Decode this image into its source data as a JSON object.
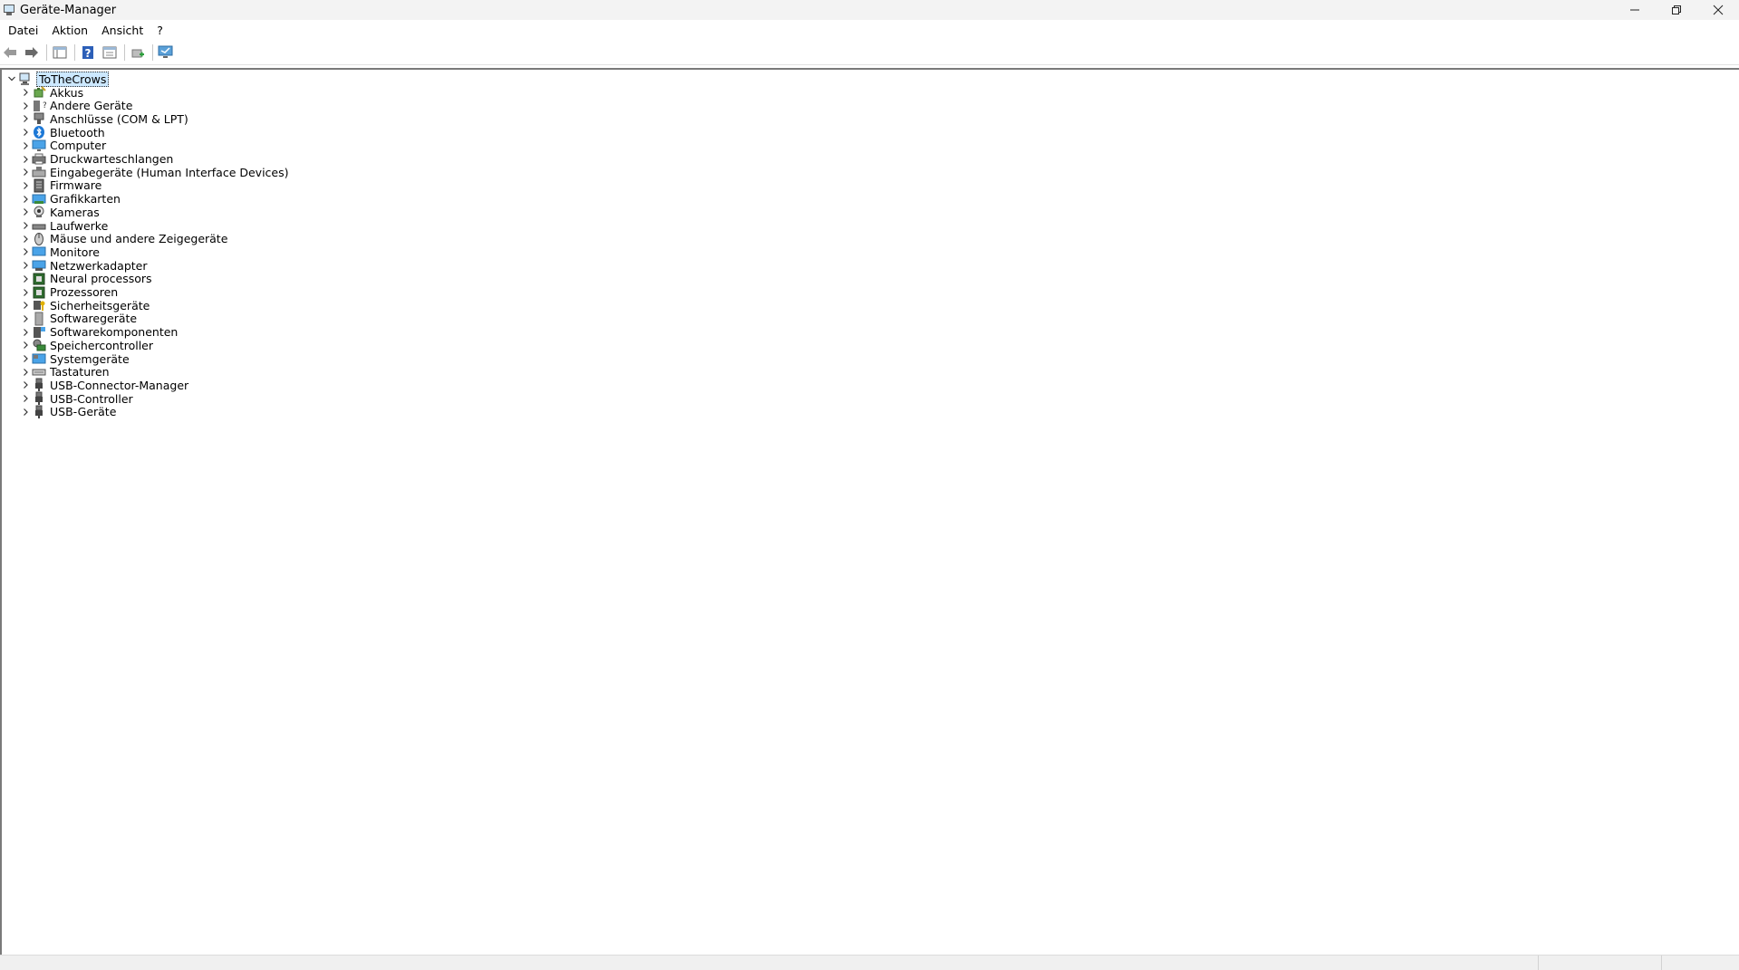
{
  "window": {
    "title": "Geräte-Manager"
  },
  "menu": [
    "Datei",
    "Aktion",
    "Ansicht",
    "?"
  ],
  "toolbar": {
    "buttons": [
      "back-arrow-icon",
      "forward-arrow-icon",
      "console-tree-icon",
      "help-icon",
      "properties-icon",
      "update-driver-icon",
      "scan-hardware-icon"
    ]
  },
  "tree": {
    "root": {
      "label": "ToTheCrows",
      "expanded": true,
      "selected": true,
      "icon": "computer-icon"
    },
    "categories": [
      {
        "label": "Akkus",
        "icon": "battery-icon"
      },
      {
        "label": "Andere Geräte",
        "icon": "unknown-device-icon"
      },
      {
        "label": "Anschlüsse (COM & LPT)",
        "icon": "port-icon"
      },
      {
        "label": "Bluetooth",
        "icon": "bluetooth-icon"
      },
      {
        "label": "Computer",
        "icon": "computer-icon"
      },
      {
        "label": "Druckwarteschlangen",
        "icon": "printer-icon"
      },
      {
        "label": "Eingabegeräte (Human Interface Devices)",
        "icon": "hid-icon"
      },
      {
        "label": "Firmware",
        "icon": "firmware-icon"
      },
      {
        "label": "Grafikkarten",
        "icon": "display-adapter-icon"
      },
      {
        "label": "Kameras",
        "icon": "camera-icon"
      },
      {
        "label": "Laufwerke",
        "icon": "disk-drive-icon"
      },
      {
        "label": "Mäuse und andere Zeigegeräte",
        "icon": "mouse-icon"
      },
      {
        "label": "Monitore",
        "icon": "monitor-icon"
      },
      {
        "label": "Netzwerkadapter",
        "icon": "network-adapter-icon"
      },
      {
        "label": "Neural processors",
        "icon": "processor-icon"
      },
      {
        "label": "Prozessoren",
        "icon": "processor-icon"
      },
      {
        "label": "Sicherheitsgeräte",
        "icon": "security-device-icon"
      },
      {
        "label": "Softwaregeräte",
        "icon": "software-device-icon"
      },
      {
        "label": "Softwarekomponenten",
        "icon": "software-component-icon"
      },
      {
        "label": "Speichercontroller",
        "icon": "storage-controller-icon"
      },
      {
        "label": "Systemgeräte",
        "icon": "system-device-icon"
      },
      {
        "label": "Tastaturen",
        "icon": "keyboard-icon"
      },
      {
        "label": "USB-Connector-Manager",
        "icon": "usb-icon"
      },
      {
        "label": "USB-Controller",
        "icon": "usb-icon"
      },
      {
        "label": "USB-Geräte",
        "icon": "usb-icon"
      }
    ]
  },
  "colors": {
    "selection": "#cce8ff",
    "titlebar": "#f3f3f3"
  }
}
